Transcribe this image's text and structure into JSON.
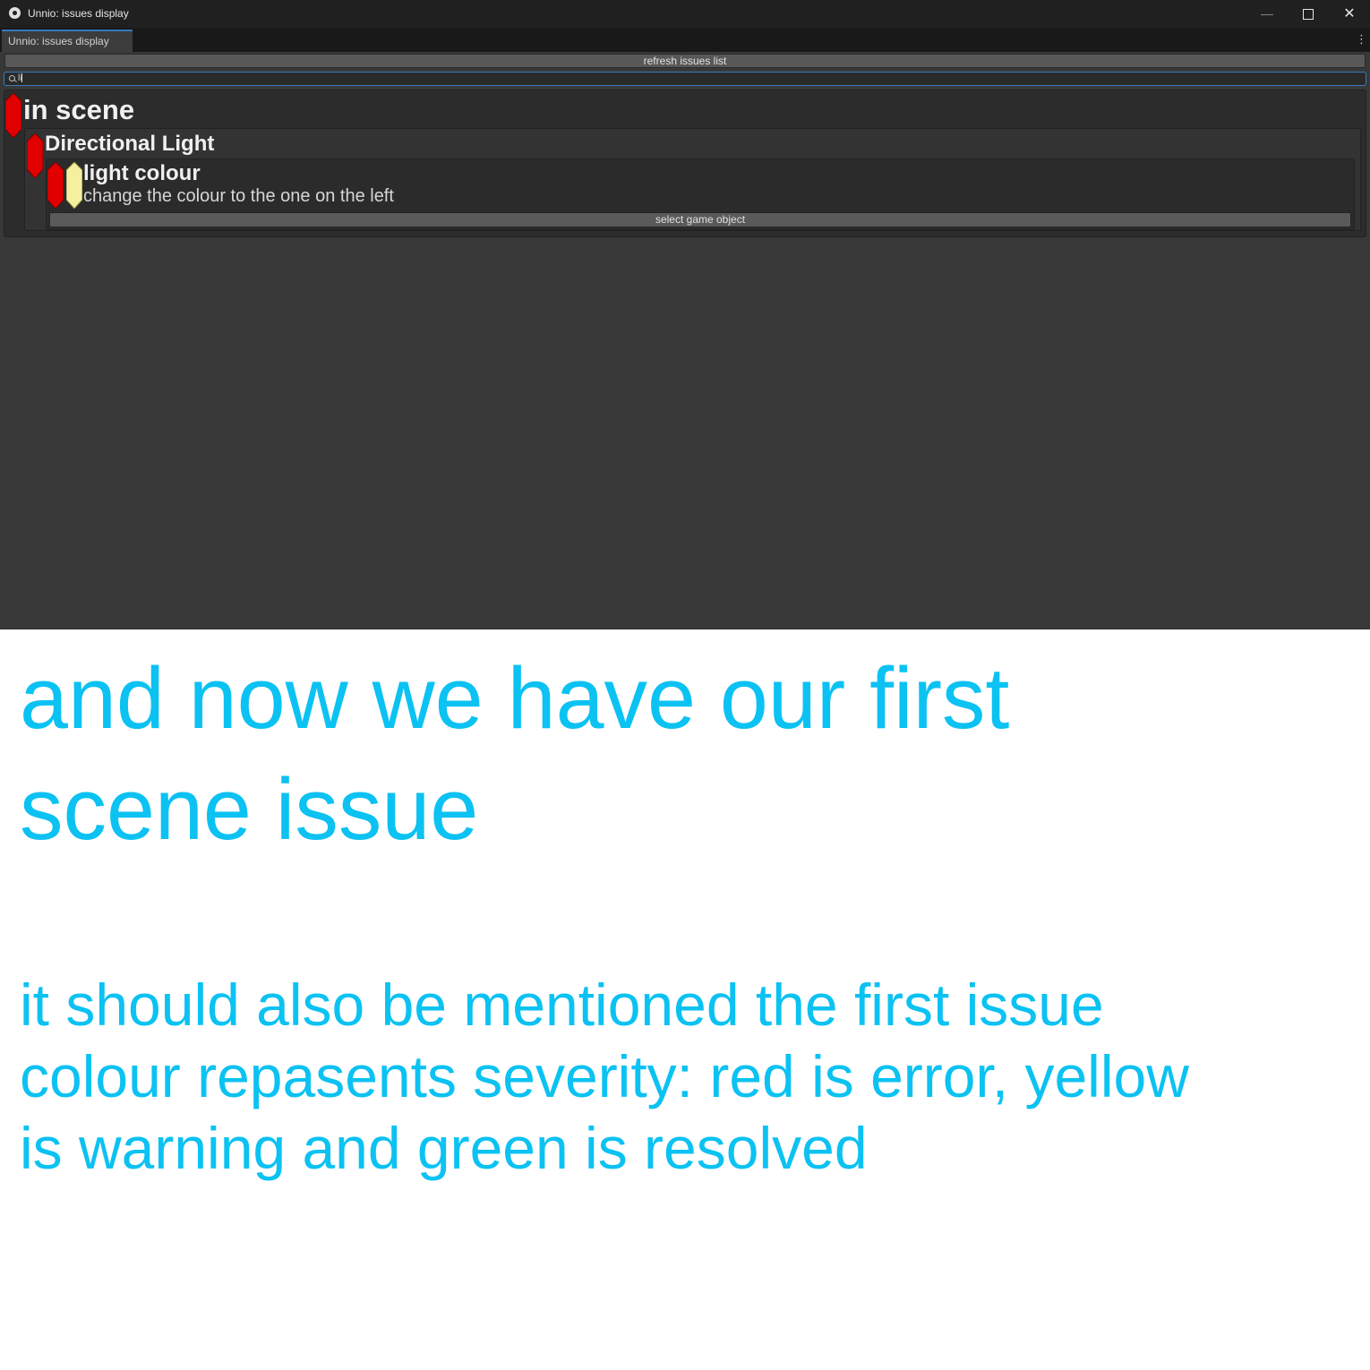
{
  "window": {
    "title": "Unnio: issues display",
    "controls": {
      "minimize": "—",
      "close": "✕"
    }
  },
  "tabs": [
    {
      "label": "Unnio: issues display"
    }
  ],
  "tab_menu_icon": "⋮",
  "toolbar": {
    "refresh_label": "refresh issues list"
  },
  "search": {
    "value": "li"
  },
  "severity_colors": {
    "error": "#e00000",
    "warning": "#f5f0a0",
    "resolved": "#00c000"
  },
  "issues": {
    "scene": {
      "title": "in scene",
      "severity": "error"
    },
    "object": {
      "name": "Directional Light",
      "severity": "error"
    },
    "issue": {
      "title": "light colour",
      "description": "change the colour to the one on the left",
      "severities": [
        "error",
        "warning"
      ],
      "action_label": "select game object"
    }
  },
  "captions": {
    "main": "and now we have our first\nscene issue",
    "note": "it should also be mentioned the first issue\ncolour repasents severity: red is error, yellow\nis warning and green is resolved"
  }
}
